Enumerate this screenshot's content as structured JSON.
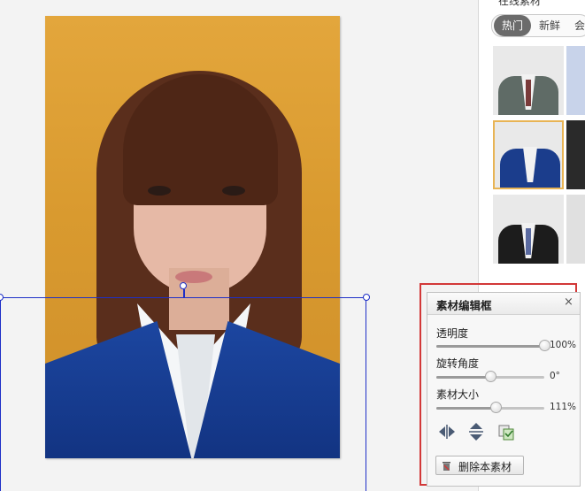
{
  "panel": {
    "title": "在线素材",
    "tabs": [
      {
        "label": "热门",
        "active": true
      },
      {
        "label": "新鲜",
        "active": false
      },
      {
        "label": "会",
        "active": false
      }
    ],
    "thumbnails": [
      {
        "name": "grey-suit",
        "color": "#5f6b66",
        "tie": "#7a3a3a",
        "selected": false
      },
      {
        "name": "blue-blazer",
        "color": "#1b3d8c",
        "tie": "",
        "selected": true
      },
      {
        "name": "black-suit",
        "color": "#1c1c1c",
        "tie": "#5a6aa0",
        "selected": false
      }
    ]
  },
  "editor": {
    "title": "素材编辑框",
    "close_label": "×",
    "opacity": {
      "label": "透明度",
      "value_text": "100%",
      "fraction": 1.0
    },
    "rotation": {
      "label": "旋转角度",
      "value_text": "0°",
      "fraction": 0.5
    },
    "size": {
      "label": "素材大小",
      "value_text": "111%",
      "fraction": 0.55
    },
    "delete_label": "删除本素材",
    "tools": [
      "flip-horizontal-icon",
      "flip-vertical-icon",
      "replace-icon"
    ]
  },
  "colors": {
    "accent_red": "#d23838",
    "selection_blue": "#1e2fc7",
    "thumb_selected": "#e8b455"
  }
}
